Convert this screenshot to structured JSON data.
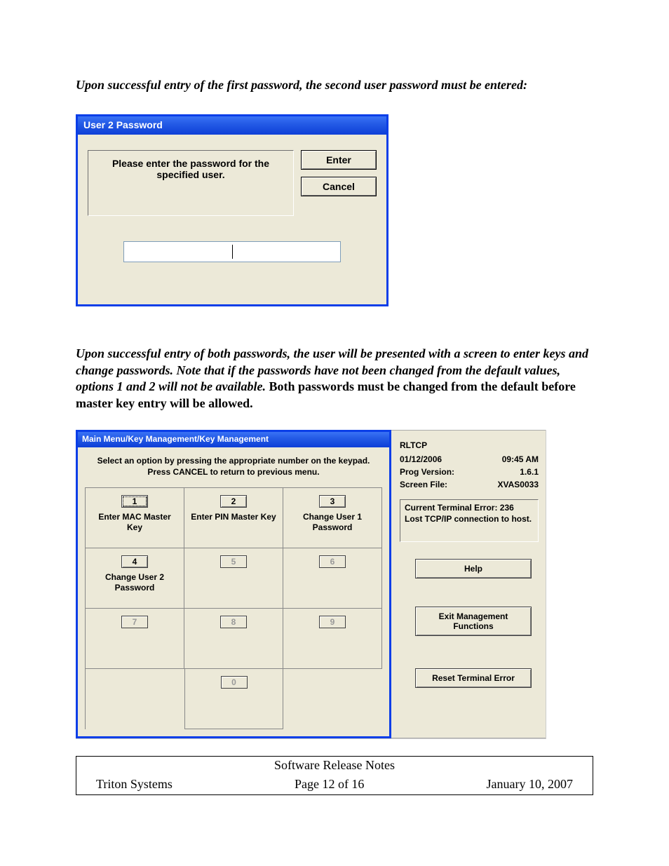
{
  "para1": "Upon successful entry of the first password, the second user password must be entered:",
  "dialog1": {
    "title": "User 2 Password",
    "message": "Please enter the password for the specified user.",
    "enter": "Enter",
    "cancel": "Cancel"
  },
  "para2a": "Upon successful entry of both passwords, the user will be presented with a screen to enter keys and change passwords.  Note that if the passwords have not been changed from the default values, options 1 and 2 will not be available.",
  "para2b": "Both passwords must be changed from the default before master key entry will be allowed.",
  "dialog2": {
    "title": "Main Menu/Key Management/Key Management",
    "instruct": "Select an option by pressing the appropriate number on the keypad. Press CANCEL to return to previous menu.",
    "keys": [
      {
        "num": "1",
        "label": "Enter MAC Master Key",
        "enabled": true,
        "focus": true
      },
      {
        "num": "2",
        "label": "Enter PIN Master Key",
        "enabled": true,
        "focus": false
      },
      {
        "num": "3",
        "label": "Change User 1 Password",
        "enabled": true,
        "focus": false
      },
      {
        "num": "4",
        "label": "Change User 2 Password",
        "enabled": true,
        "focus": false
      },
      {
        "num": "5",
        "label": "",
        "enabled": false,
        "focus": false
      },
      {
        "num": "6",
        "label": "",
        "enabled": false,
        "focus": false
      },
      {
        "num": "7",
        "label": "",
        "enabled": false,
        "focus": false
      },
      {
        "num": "8",
        "label": "",
        "enabled": false,
        "focus": false
      },
      {
        "num": "9",
        "label": "",
        "enabled": false,
        "focus": false
      }
    ],
    "zero": {
      "num": "0",
      "label": "",
      "enabled": false
    },
    "side": {
      "name": "RLTCP",
      "date": "01/12/2006",
      "time": "09:45 AM",
      "prog_label": "Prog Version:",
      "prog_value": "1.6.1",
      "screen_label": "Screen File:",
      "screen_value": "XVAS0033",
      "err_line1": "Current Terminal Error:   236",
      "err_line2": "Lost TCP/IP connection to host.",
      "help": "Help",
      "exit": "Exit Management Functions",
      "reset": "Reset Terminal Error"
    }
  },
  "footer": {
    "title": "Software Release Notes",
    "left": "Triton Systems",
    "center": "Page 12 of 16",
    "right": "January 10, 2007"
  }
}
